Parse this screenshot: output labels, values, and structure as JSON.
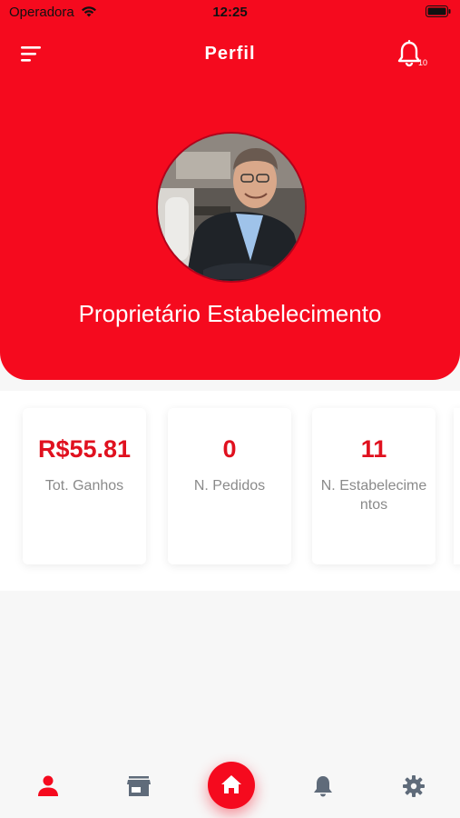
{
  "status_bar": {
    "carrier": "Operadora",
    "time": "12:25",
    "wifi_icon": "wifi-icon",
    "battery_icon": "battery-icon"
  },
  "header": {
    "title": "Perfil",
    "menu_icon": "menu-icon",
    "notification_icon": "bell-icon",
    "notification_count": "10"
  },
  "profile": {
    "name": "Proprietário Estabelecimento",
    "avatar_icon": "profile-photo"
  },
  "stats": [
    {
      "value": "R$55.81",
      "label": "Tot. Ganhos"
    },
    {
      "value": "0",
      "label": "N. Pedidos"
    },
    {
      "value": "11",
      "label": "N. Estabelecimentos"
    }
  ],
  "bottom_nav": {
    "items": [
      {
        "icon": "person-icon",
        "active": true
      },
      {
        "icon": "store-icon",
        "active": false
      },
      {
        "icon": "home-icon",
        "active": false
      },
      {
        "icon": "bell-icon",
        "active": false
      },
      {
        "icon": "gear-icon",
        "active": false
      }
    ]
  },
  "colors": {
    "primary": "#f50a1e",
    "value_text": "#e0111f",
    "label_text": "#8a8a8a",
    "nav_inactive": "#5f6b7a"
  }
}
